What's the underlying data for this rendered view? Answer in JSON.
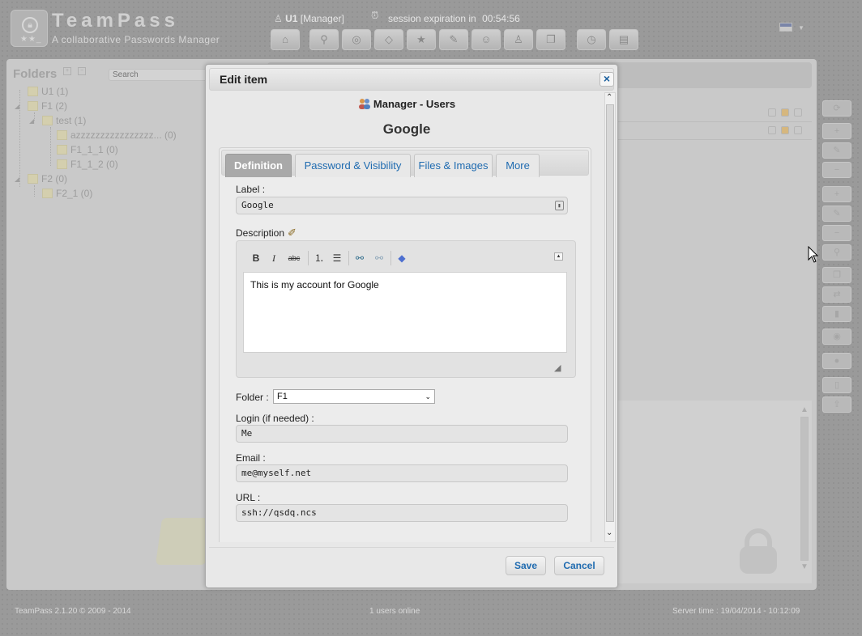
{
  "app": {
    "title": "TeamPass",
    "subtitle": "A collaborative Passwords Manager"
  },
  "header": {
    "user_name": "U1",
    "user_role": "[Manager]",
    "session_label": "session expiration in",
    "session_time": "00:54:56"
  },
  "toolbar_icons": [
    "home-icon",
    "key-icon",
    "binoculars-icon",
    "tag-icon",
    "star-icon",
    "notes-icon",
    "group-icon",
    "user-icon",
    "copy-icon",
    "history-icon",
    "book-icon"
  ],
  "folders": {
    "title": "Folders",
    "search_placeholder": "Search",
    "tree": [
      {
        "label": "U1 (1)"
      },
      {
        "label": "F1 (2)"
      },
      {
        "label": "test (1)"
      },
      {
        "label": "azzzzzzzzzzzzzzzz... (0)"
      },
      {
        "label": "F1_1_1 (0)"
      },
      {
        "label": "F1_1_2 (0)"
      },
      {
        "label": "F2 (0)"
      },
      {
        "label": "F2_1 (0)"
      }
    ]
  },
  "modal": {
    "title": "Edit item",
    "close_label": "×",
    "folder_path": "Manager - Users",
    "item_title": "Google",
    "tabs": [
      {
        "label": "Definition",
        "active": true
      },
      {
        "label": "Password & Visibility"
      },
      {
        "label": "Files & Images"
      },
      {
        "label": "More"
      }
    ],
    "label_field": {
      "label": "Label :",
      "value": "Google"
    },
    "description": {
      "label": "Description",
      "text": "This is my account for Google",
      "toolbar": {
        "bold": "B",
        "italic": "I",
        "strike": "abc"
      }
    },
    "folder_field": {
      "label": "Folder :",
      "value": "F1"
    },
    "login_field": {
      "label": "Login (if needed) :",
      "value": "Me"
    },
    "email_field": {
      "label": "Email :",
      "value": "me@myself.net"
    },
    "url_field": {
      "label": "URL :",
      "value": "ssh://qsdq.ncs"
    },
    "save_label": "Save",
    "cancel_label": "Cancel"
  },
  "footer": {
    "version": "TeamPass 2.1.20 © 2009 - 2014",
    "online": "1 users online",
    "server_time": "Server time : 19/04/2014 - 10:12:09"
  },
  "colors": {
    "link_blue": "#1f6bb0",
    "overlay_gray": "#9a9a9a",
    "active_tab": "#a9a9a9"
  }
}
